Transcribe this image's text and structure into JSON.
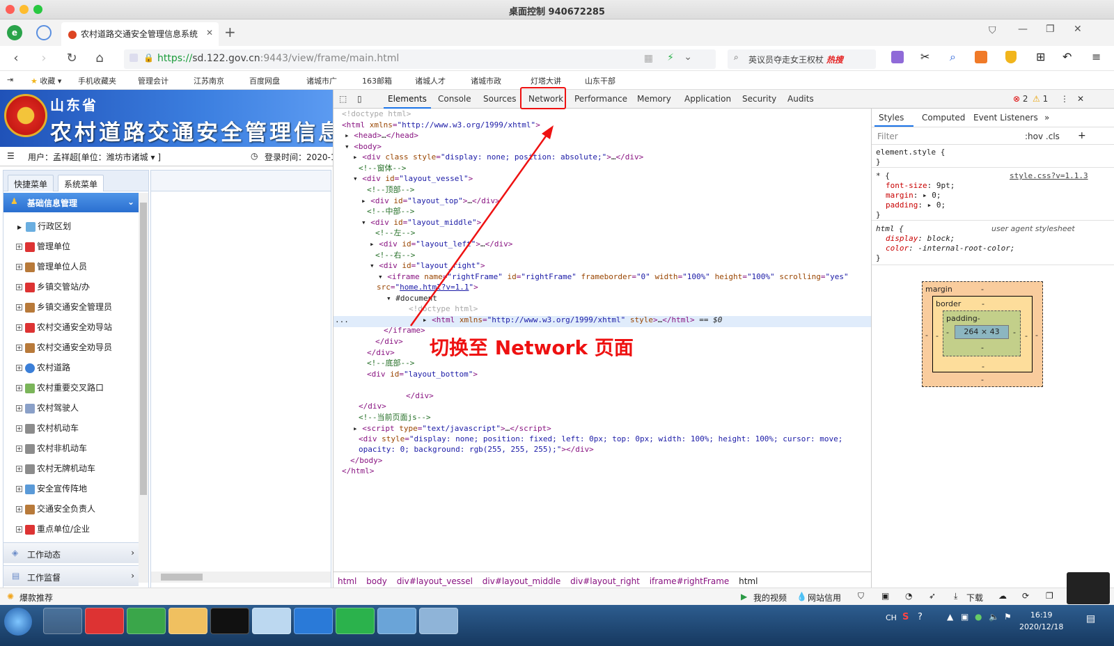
{
  "window": {
    "title": "桌面控制 940672285"
  },
  "tab": {
    "title": "农村道路交通安全管理信息系统"
  },
  "address": {
    "protocol": "https://",
    "host": "sd.122.gov.cn",
    "rest": ":9443/view/frame/main.html"
  },
  "search": {
    "text": "英议员夺走女王权杖",
    "hot": "热搜"
  },
  "bookmarks": [
    "收藏",
    "手机收藏夹",
    "管理会计",
    "江苏南京",
    "百度网盘",
    "诸城市广",
    "163邮箱",
    "诸城人才",
    "诸城市政",
    "灯塔大讲",
    "山东干部"
  ],
  "banner": {
    "province": "山东省",
    "system": "农村道路交通安全管理信息系统"
  },
  "userbar": {
    "user": "用户：孟祥超[单位：潍坊市诸城 ▾ ]",
    "login": "登录时间：2020-1"
  },
  "menu": {
    "tabs": [
      "快捷菜单",
      "系统菜单"
    ],
    "header": "基础信息管理",
    "items": [
      "行政区划",
      "管理单位",
      "管理单位人员",
      "乡镇交管站/办",
      "乡镇交通安全管理员",
      "农村交通安全劝导站",
      "农村交通安全劝导员",
      "农村道路",
      "农村重要交叉路口",
      "农村驾驶人",
      "农村机动车",
      "农村非机动车",
      "农村无牌机动车",
      "安全宣传阵地",
      "交通安全负责人",
      "重点单位/企业"
    ],
    "footer": [
      "工作动态",
      "工作监督"
    ]
  },
  "devtools": {
    "tabs": [
      "Elements",
      "Console",
      "Sources",
      "Network",
      "Performance",
      "Memory",
      "Application",
      "Security",
      "Audits"
    ],
    "errors": "2",
    "warnings": "1",
    "crumbs": [
      "html",
      "body",
      "div#layout_vessel",
      "div#layout_middle",
      "div#layout_right",
      "iframe#rightFrame",
      "html"
    ],
    "style_tabs": [
      "Styles",
      "Computed",
      "Event Listeners"
    ],
    "filter": "Filter",
    "hov": ":hov .cls",
    "element_style": "element.style {",
    "css_source": "style.css?v=1.1.3",
    "ua": "user agent stylesheet",
    "box": {
      "margin": "margin",
      "border": "border",
      "padding": "padding-",
      "content": "264 × 43",
      "dash": "-"
    }
  },
  "annotation": "切换至 Network 页面",
  "statusbar": {
    "left": "爆款推荐",
    "video": "我的视频",
    "net": "网站信用",
    "download": "下载"
  },
  "clock": {
    "time": "16:19",
    "date": "2020/12/18"
  },
  "colors": {
    "accent": "#1a73e8",
    "annotation": "#ee1111",
    "menu_header": "#2a6fd0"
  }
}
